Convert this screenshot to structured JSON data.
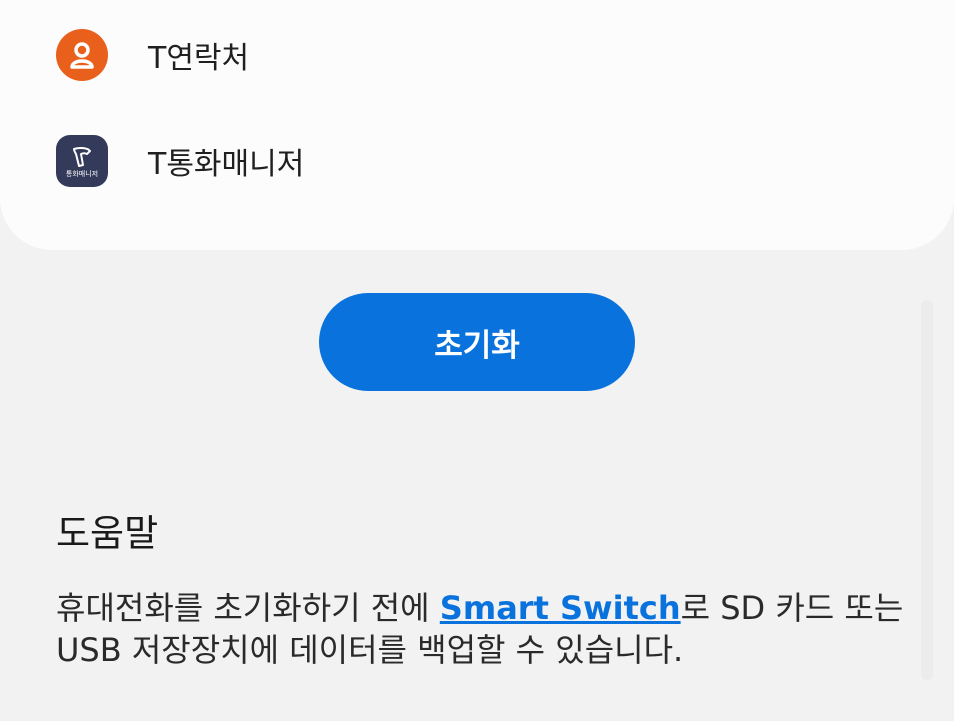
{
  "apps": [
    {
      "label": "T연락처",
      "icon": "contacts-icon",
      "color": "#e8601c"
    },
    {
      "label": "T통화매니저",
      "icon": "call-manager-icon",
      "color": "#333a5a",
      "icon_text": "통화매니저"
    }
  ],
  "reset_button": {
    "label": "초기화",
    "color": "#0a72dc"
  },
  "help": {
    "title": "도움말",
    "text_before": "휴대전화를 초기화하기 전에 ",
    "link": "Smart Switch",
    "text_after": "로 SD 카드 또는 USB 저장장치에 데이터를 백업할 수 있습니다."
  }
}
